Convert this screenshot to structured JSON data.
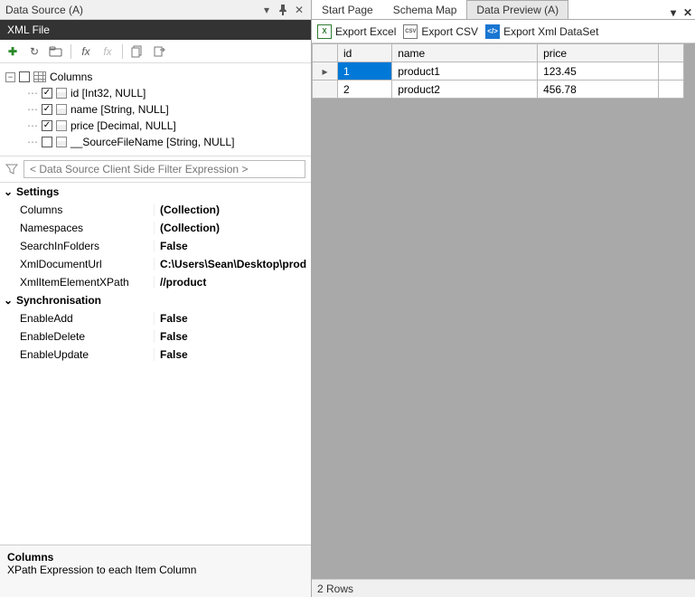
{
  "left": {
    "title": "Data Source (A)",
    "subtitle": "XML File",
    "tree": {
      "root": "Columns",
      "items": [
        {
          "checked": true,
          "label": "id [Int32, NULL]"
        },
        {
          "checked": true,
          "label": "name [String, NULL]"
        },
        {
          "checked": true,
          "label": "price [Decimal, NULL]"
        },
        {
          "checked": false,
          "label": "__SourceFileName [String, NULL]"
        }
      ]
    },
    "filter_placeholder": "< Data Source Client Side Filter Expression >",
    "settings_header": "Settings",
    "sync_header": "Synchronisation",
    "props": {
      "Columns": "(Collection)",
      "Namespaces": "(Collection)",
      "SearchInFolders": "False",
      "XmlDocumentUrl": "C:\\Users\\Sean\\Desktop\\prod",
      "XmlItemElementXPath": "//product"
    },
    "sync": {
      "EnableAdd": "False",
      "EnableDelete": "False",
      "EnableUpdate": "False"
    },
    "help_title": "Columns",
    "help_text": "XPath Expression to each Item Column"
  },
  "right": {
    "tabs": [
      "Start Page",
      "Schema Map",
      "Data Preview (A)"
    ],
    "active_tab": 2,
    "export": {
      "excel": "Export Excel",
      "csv": "Export CSV",
      "xml": "Export Xml DataSet"
    },
    "columns": [
      "id",
      "name",
      "price"
    ],
    "rows": [
      {
        "id": "1",
        "name": "product1",
        "price": "123.45"
      },
      {
        "id": "2",
        "name": "product2",
        "price": "456.78"
      }
    ],
    "status": "2 Rows"
  }
}
